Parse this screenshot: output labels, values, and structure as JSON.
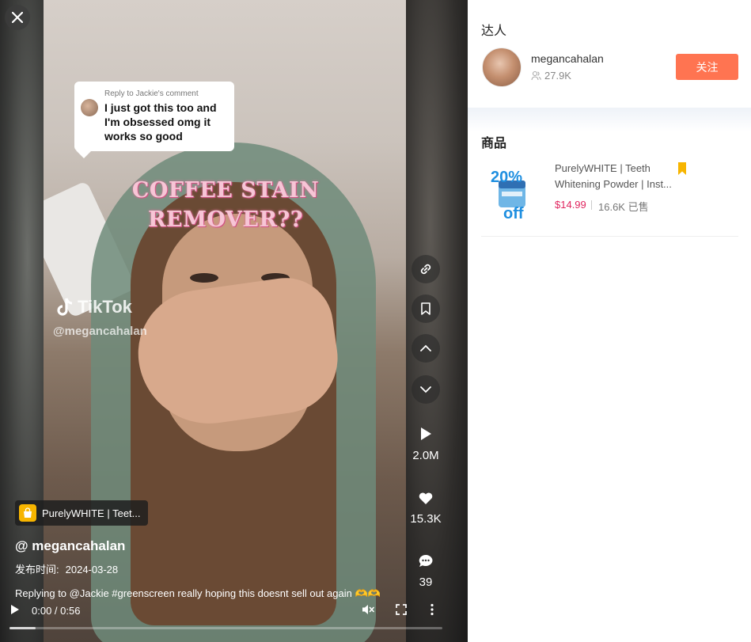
{
  "video": {
    "reply_header": "Reply to Jackie's comment",
    "reply_text": "I just got this too and I'm obsessed omg it works so good",
    "overlay_line1": "COFFEE STAIN",
    "overlay_line2": "REMOVER??",
    "watermark_brand": "TikTok",
    "watermark_handle": "@megancahalan",
    "product_chip": "PurelyWHITE | Teet...",
    "author": "@ megancahalan",
    "publish_label": "发布时间:",
    "publish_date": "2024-03-28",
    "caption": "Replying to @Jackie #greenscreen really hoping this doesnt sell out again 🫶🫶",
    "time": "0:00 / 0:56",
    "progress": 0.06
  },
  "sidebar_metrics": {
    "plays": "2.0M",
    "likes": "15.3K",
    "comments": "39"
  },
  "panel": {
    "creator_section_title": "达人",
    "creator_name": "megancahalan",
    "creator_followers": "27.9K",
    "follow_label": "关注",
    "products_section_title": "商品",
    "product_title": "PurelyWHITE | Teeth Whitening Powder | Inst...",
    "product_price": "$14.99",
    "product_sold": "16.6K 已售",
    "thumb_badge_line1": "20%",
    "thumb_badge_line2": "off"
  },
  "colors": {
    "follow_button": "#ff7451",
    "price": "#e0245e",
    "bookmark": "#f7b500",
    "overlay_text": "#f7c5d6"
  },
  "icons": [
    "close-icon",
    "link-icon",
    "bookmark-icon",
    "chevron-up-icon",
    "chevron-down-icon",
    "play-icon",
    "heart-icon",
    "comment-icon",
    "shopping-bag-icon",
    "mute-icon",
    "fullscreen-icon",
    "more-icon",
    "followers-icon"
  ]
}
